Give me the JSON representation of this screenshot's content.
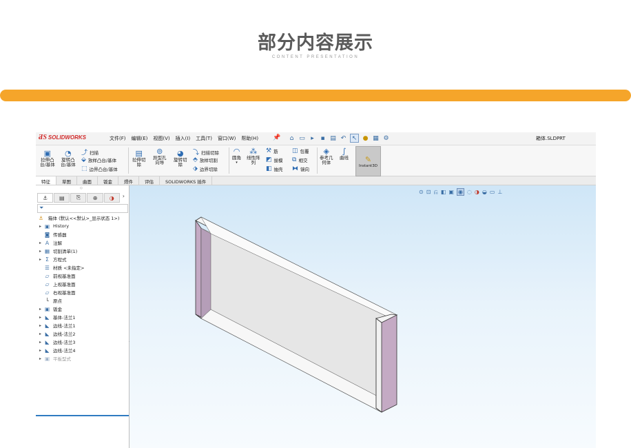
{
  "header": {
    "title": "部分内容展示",
    "subtitle": "CONTENT PRESENTATION"
  },
  "colors": {
    "accent_bar": "#f5a52a",
    "logo_red": "#d12a2a",
    "part_face_purple": "#c4aac4"
  },
  "app": {
    "logo": {
      "mark": "ƋS",
      "name": "SOLIDWORKS"
    },
    "menus": [
      "文件(F)",
      "编辑(E)",
      "视图(V)",
      "插入(I)",
      "工具(T)",
      "窗口(W)",
      "帮助(H)"
    ],
    "document_title": "箱体.SLDPRT",
    "quick_icons": [
      "home-icon",
      "new-document-icon",
      "open-icon",
      "save-icon",
      "print-icon",
      "undo-icon",
      "select-arrow-icon",
      "traffic-light-icon",
      "file-properties-icon",
      "options-gear-icon"
    ],
    "ribbon": {
      "extrude_boss": "拉伸凸\n台/基体",
      "revolve_boss": "旋转凸\n台/基体",
      "sweep": "扫描",
      "loft_boss": "放样凸台/基体",
      "boundary_boss": "边界凸台/基体",
      "extrude_cut": "拉伸切\n除",
      "hole_wizard": "异型孔\n向导",
      "revolve_cut": "旋转切\n除",
      "sweep_cut": "扫描切除",
      "loft_cut": "放样切割",
      "boundary_cut": "边界切除",
      "fillet": "圆角",
      "linear_pattern": "线性阵\n列",
      "rib": "筋",
      "draft": "拔模",
      "shell": "抽壳",
      "wrap": "包覆",
      "intersect": "相交",
      "mirror": "镜向",
      "reference_geometry": "参考几\n何体",
      "curves": "曲线",
      "instant3d": "Instant3D"
    },
    "tabs": [
      "特征",
      "草图",
      "曲面",
      "钣金",
      "焊件",
      "评估",
      "SOLIDWORKS 插件"
    ],
    "active_tab": "特征",
    "feature_tree": {
      "root": "箱体  (默认<<默认>_显示状态 1>)",
      "items": [
        {
          "label": "History",
          "expandable": true,
          "icon": "history-folder-icon"
        },
        {
          "label": "传感器",
          "expandable": false,
          "icon": "sensor-icon"
        },
        {
          "label": "注解",
          "expandable": true,
          "icon": "annotation-icon"
        },
        {
          "label": "切割清单(1)",
          "expandable": true,
          "icon": "cut-list-icon"
        },
        {
          "label": "方程式",
          "expandable": true,
          "icon": "equation-icon"
        },
        {
          "label": "材质 <未指定>",
          "expandable": false,
          "icon": "material-icon"
        },
        {
          "label": "前视基准面",
          "expandable": false,
          "icon": "plane-icon"
        },
        {
          "label": "上视基准面",
          "expandable": false,
          "icon": "plane-icon"
        },
        {
          "label": "右视基准面",
          "expandable": false,
          "icon": "plane-icon"
        },
        {
          "label": "原点",
          "expandable": false,
          "icon": "origin-icon"
        },
        {
          "label": "钣金",
          "expandable": true,
          "icon": "sheet-metal-icon"
        },
        {
          "label": "基体-法兰1",
          "expandable": true,
          "icon": "base-flange-icon"
        },
        {
          "label": "边线-法兰1",
          "expandable": true,
          "icon": "edge-flange-icon"
        },
        {
          "label": "边线-法兰2",
          "expandable": true,
          "icon": "edge-flange-icon"
        },
        {
          "label": "边线-法兰3",
          "expandable": true,
          "icon": "edge-flange-icon"
        },
        {
          "label": "边线-法兰4",
          "expandable": true,
          "icon": "edge-flange-icon"
        },
        {
          "label": "平板型式",
          "expandable": true,
          "icon": "flat-pattern-icon",
          "dim": true
        }
      ]
    },
    "heads_up_icons": [
      "zoom-fit-icon",
      "zoom-area-icon",
      "previous-view-icon",
      "section-view-icon",
      "view-orientation-icon",
      "display-style-icon",
      "hide-show-icon",
      "appearance-icon",
      "scene-icon",
      "display-settings-icon",
      "triad-icon"
    ]
  }
}
